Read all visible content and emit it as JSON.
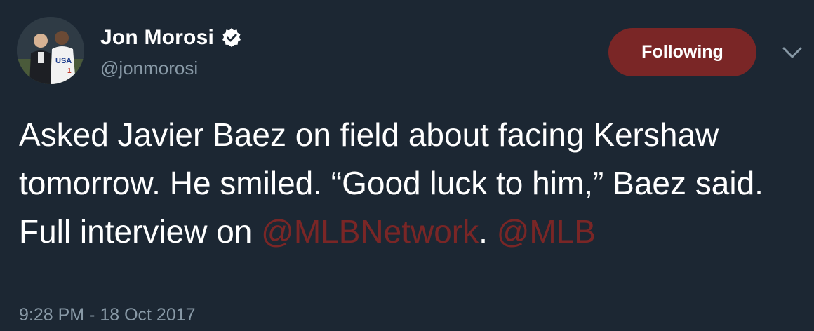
{
  "user": {
    "display_name": "Jon Morosi",
    "handle": "@jonmorosi",
    "verified": true
  },
  "follow_button": {
    "label": "Following"
  },
  "tweet": {
    "text_before": "Asked Javier Baez on field about facing Kershaw tomorrow. He smiled. “Good luck to him,” Baez said. Full interview on ",
    "mention_1": "@MLBNetwork",
    "text_between": ". ",
    "mention_2": "@MLB",
    "timestamp": "9:28 PM - 18 Oct 2017"
  },
  "icons": {
    "verified": "verified-badge-icon",
    "menu": "chevron-down-icon"
  },
  "colors": {
    "background": "#1c2733",
    "accent": "#7a2626",
    "secondary_text": "#8899a6"
  }
}
